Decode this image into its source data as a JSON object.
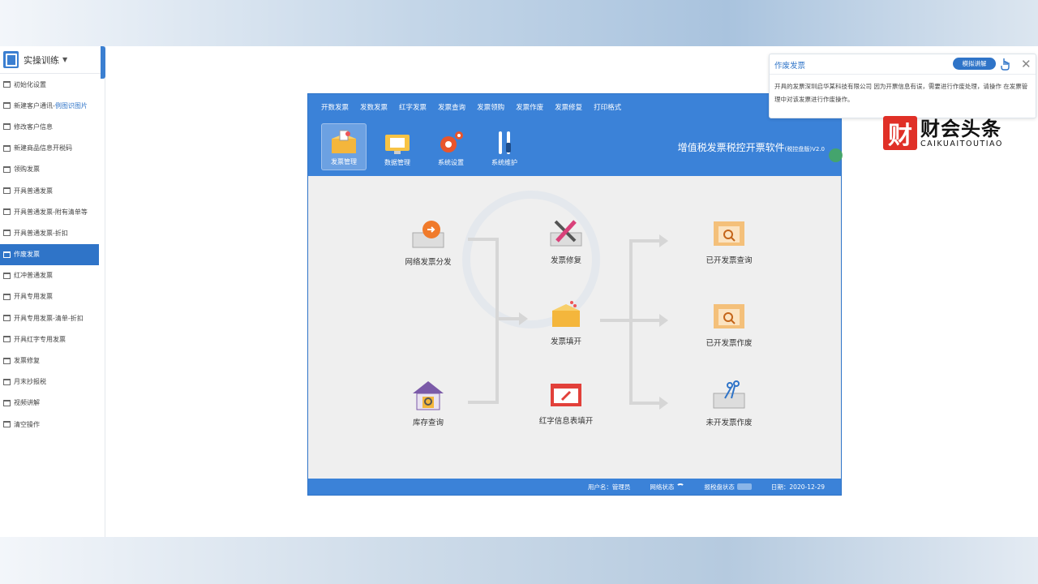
{
  "sidebar": {
    "title": "实操训练",
    "items": [
      {
        "label": "初始化设置",
        "highlight": ""
      },
      {
        "label": "新建客户通讯-",
        "highlight": "例图识图片"
      },
      {
        "label": "修改客户信息",
        "highlight": ""
      },
      {
        "label": "新建商品信息开税码",
        "highlight": ""
      },
      {
        "label": "领购发票",
        "highlight": ""
      },
      {
        "label": "开具普通发票",
        "highlight": ""
      },
      {
        "label": "开具普通发票-附有清单等",
        "highlight": ""
      },
      {
        "label": "开具普通发票-折扣",
        "highlight": ""
      },
      {
        "label": "作废发票",
        "highlight": "",
        "active": true
      },
      {
        "label": "红冲普通发票",
        "highlight": ""
      },
      {
        "label": "开具专用发票",
        "highlight": ""
      },
      {
        "label": "开具专用发票-清单-折扣",
        "highlight": ""
      },
      {
        "label": "开具红字专用发票",
        "highlight": ""
      },
      {
        "label": "发票修复",
        "highlight": ""
      },
      {
        "label": "月末抄报税",
        "highlight": ""
      },
      {
        "label": "视频讲解",
        "highlight": ""
      },
      {
        "label": "清空操作",
        "highlight": ""
      }
    ]
  },
  "app": {
    "menu": [
      "开数发票",
      "发数发票",
      "红字发票",
      "发票查询",
      "发票领购",
      "发票作废",
      "发票修复",
      "打印格式"
    ],
    "toolbar": [
      "发票管理",
      "数据管理",
      "系统设置",
      "系统维护"
    ],
    "title": "增值税发票税控开票软件",
    "title_suffix": "(税控盘版)V2.0",
    "nodes": {
      "network_dist": "网络发票分发",
      "inventory": "库存查询",
      "repair": "发票修复",
      "fill": "发票填开",
      "red_info": "红字信息表填开",
      "issued_query": "已开发票查询",
      "issued_void": "已开发票作废",
      "unissued_void": "未开发票作废"
    },
    "status": {
      "user": "用户名：管理员",
      "network": "网络状态",
      "disk": "报税盘状态",
      "date": "日期：2020-12-29"
    }
  },
  "popup": {
    "title": "作废发票",
    "button": "模拟讲解",
    "text": "开具的发票深圳启华某科技有限公司 因为开票信息有误，需要进行作废处理，请操作 在发票管理中对该发票进行作废操作。"
  },
  "logo": {
    "badge": "财",
    "cn": "财会头条",
    "en": "CAIKUAITOUTIAO"
  }
}
